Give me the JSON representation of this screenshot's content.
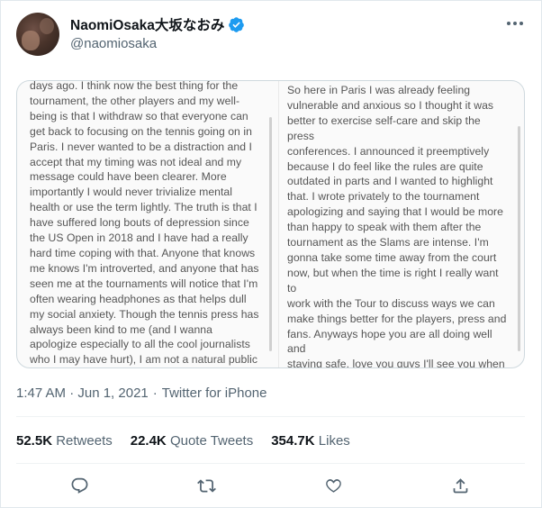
{
  "tweet": {
    "display_name": "NaomiOsaka大坂なおみ",
    "handle": "@naomiosaka",
    "timestamp": "1:47 AM · Jun 1, 2021",
    "separator": "·",
    "source": "Twitter for iPhone",
    "verified_color": "#1d9bf0",
    "accent_heart_color": "#e0245e",
    "image": {
      "left_text": "days ago. I think now the best thing for the\ntournament, the other players and my well-\nbeing is that I withdraw so that everyone can\nget back to focusing on the tennis going on in\nParis. I never wanted to be a distraction and I\naccept that my timing was not ideal and my\nmessage could have been clearer. More\nimportantly I would never trivialize mental\nhealth or use the term lightly. The truth is that I\nhave suffered long bouts of depression since\nthe US Open in 2018 and I have had a really\nhard time coping with that. Anyone that knows\nme knows I'm introverted, and anyone that has\nseen me at the tournaments will notice that I'm\noften wearing headphones as that helps dull\nmy social anxiety. Though the tennis press has\nalways been kind to me (and I wanna\napologize especially to all the cool journalists\nwho I may have hurt), I am not a natural public\nspeaker and get huge waves of anxiety before",
      "right_text": "So here in Paris I was already feeling\nvulnerable and anxious so I thought it was\nbetter to exercise self-care and skip the press\nconferences. I announced it preemptively\nbecause I do feel like the rules are quite\noutdated in parts and I wanted to highlight\nthat. I wrote privately to the tournament\napologizing and saying that I would be more\nthan happy to speak with them after the\ntournament as the Slams are intense. I'm\ngonna take some time away from the court\nnow, but when the time is right I really want to\nwork with the Tour to discuss ways we can\nmake things better for the players, press and\nfans. Anyways hope you are all doing well and\nstaying safe, love you guys I'll see you when I\nsee you"
    },
    "stats": [
      {
        "count": "52.5K",
        "label": "Retweets"
      },
      {
        "count": "22.4K",
        "label": "Quote Tweets"
      },
      {
        "count": "354.7K",
        "label": "Likes"
      }
    ],
    "actions": [
      "reply-icon",
      "retweet-icon",
      "like-icon",
      "share-icon"
    ]
  }
}
